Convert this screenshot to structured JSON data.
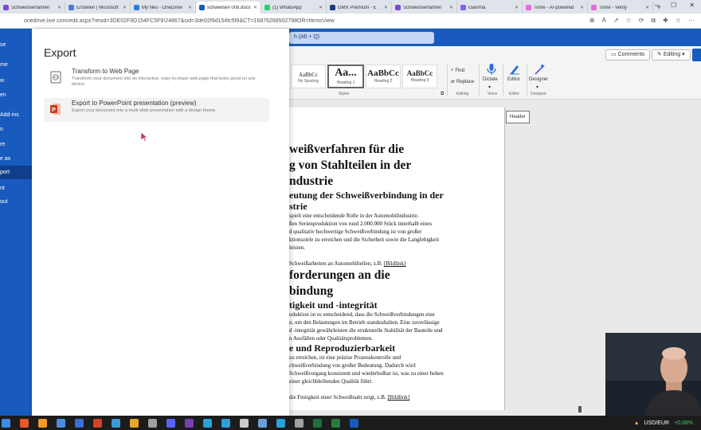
{
  "browser": {
    "tabs": [
      {
        "title": "Schweißverfahren",
        "color": "#7a4bd1",
        "active": false
      },
      {
        "title": "Erstellen | Microsoft",
        "color": "#4a7bd8",
        "active": false
      },
      {
        "title": "My files - OneDrive",
        "color": "#2f7cd8",
        "active": false
      },
      {
        "title": "schweißen 008.docx",
        "color": "#185abd",
        "active": true
      },
      {
        "title": "(1) WhatsApp",
        "color": "#25d366",
        "active": false
      },
      {
        "title": "GMX Premium - E",
        "color": "#1c3d7a",
        "active": false
      },
      {
        "title": "Schweißverfahren",
        "color": "#7a4bd1",
        "active": false
      },
      {
        "title": "Gamma",
        "color": "#8a5cf0",
        "active": false
      },
      {
        "title": "Tome - AI-powered",
        "color": "#e86ad9",
        "active": false
      },
      {
        "title": "Tome - Verify",
        "color": "#e86ad9",
        "active": false
      }
    ],
    "url": "onedrive.live.com/edit.aspx?resid=3DE02F9D154FC5F9!24867&cid=3de02f9d154fc5f9&CT=16876268502798OR=ItemsView"
  },
  "word": {
    "search_text": "h (Alt + Q)",
    "comments_label": "Comments",
    "editing_label": "Editing",
    "styles": [
      {
        "sample": "AaBbCc",
        "name": "No Spacing"
      },
      {
        "sample": "Aa...",
        "name": "Heading 1"
      },
      {
        "sample": "AaBbCc",
        "name": "Heading 2"
      },
      {
        "sample": "AaBbCc",
        "name": "Heading 3"
      }
    ],
    "find_label": "Find",
    "replace_label": "Replace",
    "dictate_label": "Dictate",
    "editor_label": "Editor",
    "designer_label": "Designer",
    "groups": {
      "styles": "Styles",
      "editing": "Editing",
      "voice": "Voice",
      "editor": "Editor",
      "designer": "Designer"
    },
    "header_tag": "Header"
  },
  "document": {
    "lines": [
      {
        "t": "h1",
        "text": "weißverfahren für die"
      },
      {
        "t": "h1",
        "text": "g von Stahlteilen in der"
      },
      {
        "t": "h1",
        "text": "ndustrie"
      },
      {
        "t": "h2",
        "text": "eutung der Schweißverbindung in der"
      },
      {
        "t": "h2",
        "text": "strie"
      },
      {
        "t": "p",
        "text": "spielt eine entscheidende Rolle in der Automobilindustrie."
      },
      {
        "t": "p",
        "text": "ßen Serienproduktion von rund 2.000.000 Stück innerhalb eines"
      },
      {
        "t": "p",
        "text": "d qualitativ hochwertige Schweißverbindung ist von großer"
      },
      {
        "t": "p",
        "text": "ktionsziele zu erreichen und die Sicherheit sowie die Langlebigkeit"
      },
      {
        "t": "p",
        "text": "leisten."
      },
      {
        "t": "blank",
        "text": ""
      },
      {
        "t": "p",
        "text": "Schweißarbeiten an Automobilteilen, z.B. [Bildlink]"
      },
      {
        "t": "h1",
        "text": "forderungen an die"
      },
      {
        "t": "h1",
        "text": "bindung"
      },
      {
        "t": "h2",
        "text": "tigkeit und -integrität"
      },
      {
        "t": "p",
        "text": "oduktion ist es entscheidend, dass die Schweißverbindungen eine"
      },
      {
        "t": "p",
        "text": "n, um den Belastungen im Betrieb standzuhalten. Eine zuverlässige"
      },
      {
        "t": "p",
        "text": "d -integrität gewährleisten die strukturelle Stabilität der Bauteile und"
      },
      {
        "t": "p",
        "text": "n Ausfällen oder Qualitätsproblemen."
      },
      {
        "t": "h2",
        "text": "e und Reproduzierbarkeit"
      },
      {
        "t": "p",
        "text": "zu erreichen, ist eine präzise Prozesskontrolle und"
      },
      {
        "t": "p",
        "text": "chweißverbindung von großer Bedeutung. Dadurch wird"
      },
      {
        "t": "p",
        "text": "Schweißvorgang konsistent und wiederholbar ist, was zu einer hohen"
      },
      {
        "t": "p",
        "text": "einer gleichbleibenden Qualität führt."
      },
      {
        "t": "blank",
        "text": ""
      },
      {
        "t": "p",
        "text": "die Festigkeit einer Schweißnaht zeigt, z.B. [Bildlink]"
      }
    ]
  },
  "nav": {
    "items": [
      {
        "label": "se",
        "selected": false
      },
      {
        "label": "me",
        "selected": false
      },
      {
        "label": "w",
        "selected": false
      },
      {
        "label": "en",
        "selected": false
      },
      {
        "label": " Add-ins",
        "selected": false
      },
      {
        "label": "o",
        "selected": false
      },
      {
        "label": "re",
        "selected": false
      },
      {
        "label": "e as",
        "selected": false
      },
      {
        "label": "port",
        "selected": true
      },
      {
        "label": "nt",
        "selected": false
      },
      {
        "label": "out",
        "selected": false
      }
    ]
  },
  "export": {
    "title": "Export",
    "options": [
      {
        "title": "Transform to Web Page",
        "desc": "Transform your document into an interactive, easy-to-share web page that looks great on any device."
      },
      {
        "title": "Export to PowerPoint presentation (preview)",
        "desc": "Export your document into a multi-slide presentation with a design theme."
      }
    ]
  },
  "taskbar": {
    "ticker": "USD/EUR",
    "ticker_change": "+0,08%",
    "icons": [
      "#e8572a",
      "#f09a2a",
      "#4a8de0",
      "#3a6fd0",
      "#d4432a",
      "#3c9ad8",
      "#e8a32a",
      "#a0a0a0",
      "#5865f2",
      "#7a3fb0",
      "#2aa1d8",
      "#2aa1d8",
      "#cccccc",
      "#6aa0d8",
      "#2aa1d8",
      "#a0a0a0",
      "#1d6f42",
      "#2b7a3d",
      "#185abd"
    ]
  },
  "colors": {
    "accent": "#185abd",
    "nav_selected": "#0f3f8c"
  }
}
